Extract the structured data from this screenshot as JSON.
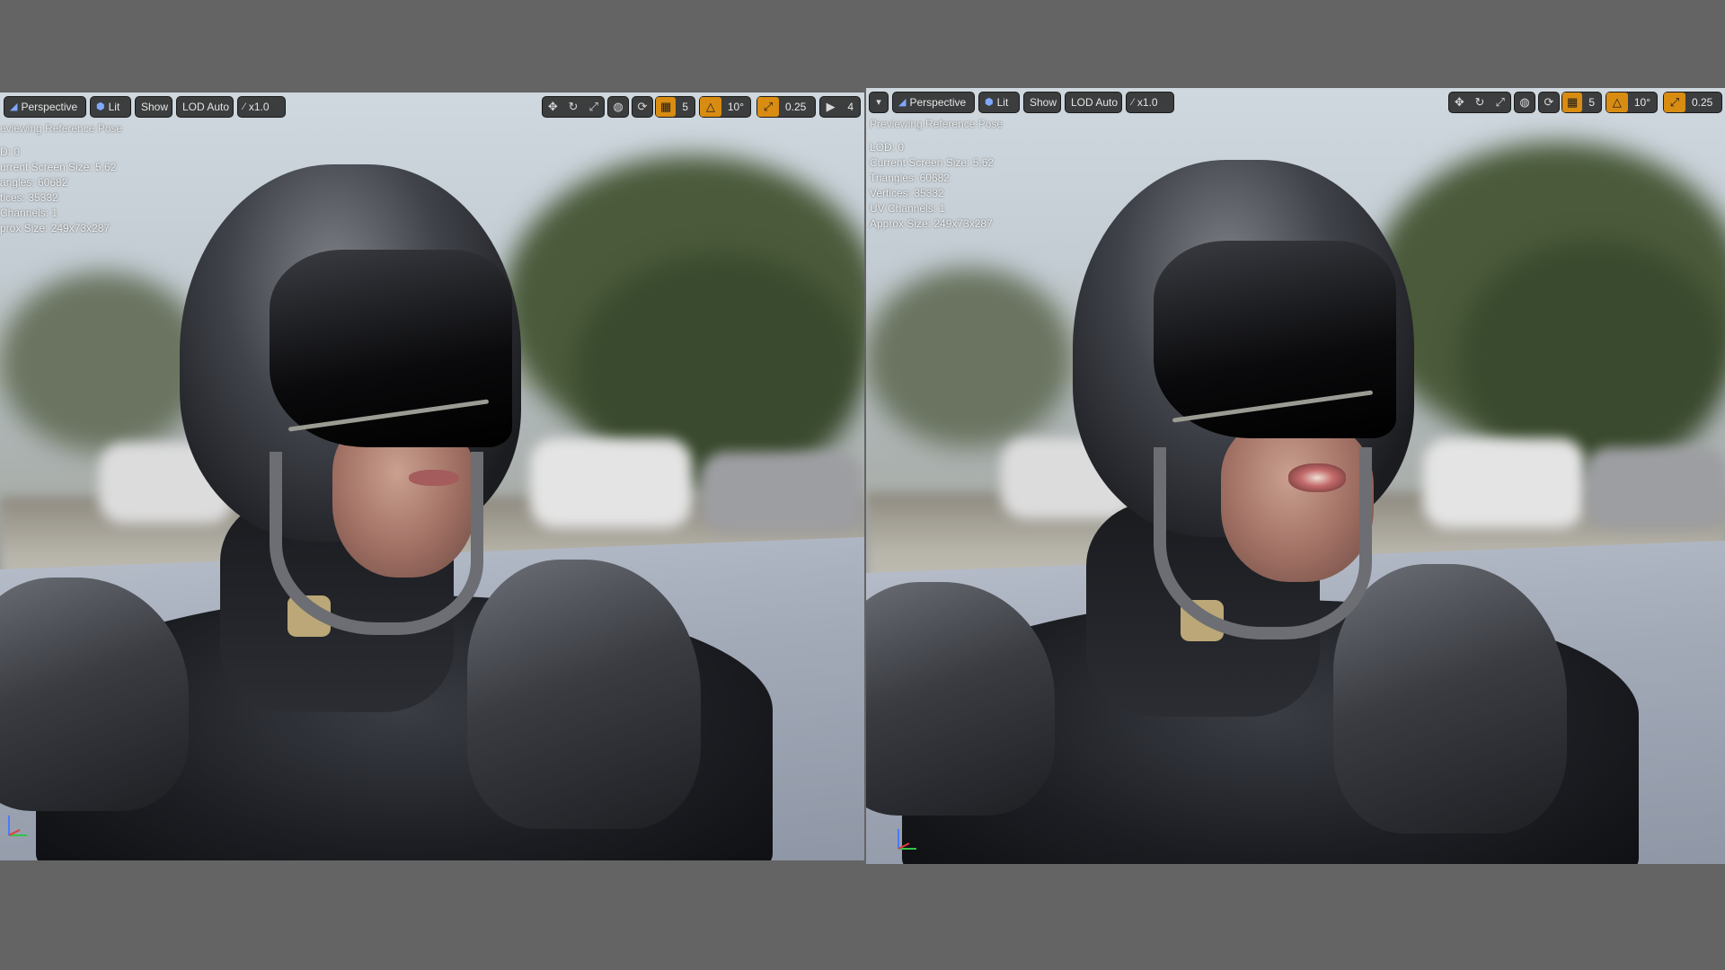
{
  "viewports": [
    {
      "id": "left",
      "toolbar": {
        "perspective_label": "Perspective",
        "lit_label": "Lit",
        "show_label": "Show",
        "lod_label": "LOD Auto",
        "speed_label": "x1.0",
        "grid_snap_value": "5",
        "rotation_snap_value": "10°",
        "scale_snap_value": "0.25",
        "camera_speed_value": "4"
      },
      "preview_label": "eviewing Reference Pose",
      "stats": [
        "D: 0",
        "urrent Screen Size: 5.62",
        "angles: 60682",
        "tices: 35332",
        "Channels: 1",
        "prox Size: 249x73x287"
      ],
      "mouth_state": "closed"
    },
    {
      "id": "right",
      "toolbar": {
        "perspective_label": "Perspective",
        "lit_label": "Lit",
        "show_label": "Show",
        "lod_label": "LOD Auto",
        "speed_label": "x1.0",
        "grid_snap_value": "5",
        "rotation_snap_value": "10°",
        "scale_snap_value": "0.25"
      },
      "preview_label": "Previewing Reference Pose",
      "stats": [
        "LOD: 0",
        "Current Screen Size: 5.62",
        "Triangles: 60682",
        "Vertices: 35332",
        "UV Channels: 1",
        "Approx Size: 249x73x287"
      ],
      "mouth_state": "open"
    }
  ],
  "colors": {
    "toolbar_bg": "#282828",
    "snap_active": "#d88c12",
    "page_bg": "#646464",
    "lit_icon": "#7fa8ff"
  },
  "icons": {
    "perspective": "perspective-icon",
    "lit": "lit-sphere-icon",
    "speed": "camera-speed-icon",
    "translate": "translate-icon",
    "rotate": "rotate-icon",
    "scale": "scale-icon",
    "world_local": "world-local-icon",
    "surface_snap": "surface-snap-icon",
    "grid_snap": "grid-snap-icon",
    "rotation_snap": "rotation-snap-icon",
    "scale_snap": "scale-snap-icon",
    "camera_speed": "camera-icon",
    "options": "options-dropdown-icon"
  }
}
